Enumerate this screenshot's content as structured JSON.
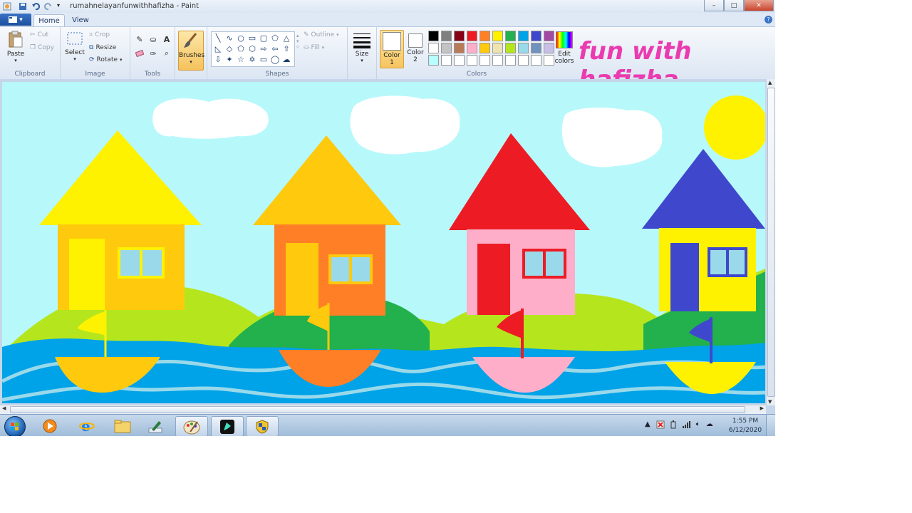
{
  "window": {
    "title": "rumahnelayanfunwithhafizha - Paint",
    "controls": {
      "minimize": "–",
      "maximize": "□",
      "close": "✕"
    }
  },
  "tabs": {
    "app_menu_icon": "paint-menu-icon",
    "home": "Home",
    "view": "View",
    "help": "?"
  },
  "ribbon": {
    "clipboard": {
      "label": "Clipboard",
      "paste": "Paste",
      "cut": "Cut",
      "copy": "Copy"
    },
    "image": {
      "label": "Image",
      "select": "Select",
      "crop": "Crop",
      "resize": "Resize",
      "rotate": "Rotate"
    },
    "tools": {
      "label": "Tools",
      "items": [
        "pencil-icon",
        "fill-bucket-icon",
        "text-icon",
        "eraser-icon",
        "color-picker-icon",
        "magnifier-icon"
      ]
    },
    "brushes": {
      "label": "Brushes"
    },
    "shapes": {
      "label": "Shapes",
      "outline": "Outline",
      "fill": "Fill"
    },
    "size": {
      "label": "Size"
    },
    "colors": {
      "label": "Colors",
      "color1": {
        "line1": "Color",
        "line2": "1",
        "value": "#ffffff"
      },
      "color2": {
        "line1": "Color",
        "line2": "2",
        "value": "#ffffff"
      },
      "edit": {
        "line1": "Edit",
        "line2": "colors"
      },
      "palette": [
        "#000000",
        "#7f7f7f",
        "#880015",
        "#ed1c24",
        "#ff7f27",
        "#fff200",
        "#22b14c",
        "#00a2e8",
        "#3f48cc",
        "#a349a4",
        "#ffffff",
        "#c3c3c3",
        "#b97a57",
        "#ffaec9",
        "#ffc90e",
        "#efe4b0",
        "#b5e61d",
        "#99d9ea",
        "#7092be",
        "#c8bfe7",
        "#b7ffff",
        "#ffffff",
        "#ffffff",
        "#ffffff",
        "#ffffff",
        "#ffffff",
        "#ffffff",
        "#ffffff",
        "#ffffff",
        "#ffffff"
      ]
    }
  },
  "watermark": "fun with hafizha",
  "painting": {
    "colors": {
      "sky": "#b7f8fb",
      "cloud": "#ffffff",
      "sun": "#fff200",
      "hill_light": "#b5e61d",
      "hill_dark": "#22b14c",
      "sea": "#00a2e8",
      "wave": "#99d9ea",
      "house1_roof": "#fff200",
      "house1_wall": "#ffc90e",
      "house1_door": "#fff200",
      "house2_roof": "#ffc90e",
      "house2_wall": "#ff7f27",
      "house2_door": "#ffc90e",
      "house3_roof": "#ed1c24",
      "house3_wall": "#ffaec9",
      "house3_door": "#ed1c24",
      "house4_roof": "#3f48cc",
      "house4_wall": "#fff200",
      "house4_door": "#3f48cc",
      "boat1": "#ffc90e",
      "boat2": "#ff7f27",
      "boat3": "#ffaec9",
      "boat4": "#fff200"
    }
  },
  "taskbar": {
    "items": [
      "media-player-icon",
      "internet-explorer-icon",
      "file-explorer-icon",
      "pen-app-icon",
      "paint-icon",
      "filmora-icon",
      "security-shield-icon"
    ],
    "tray_icons": [
      "show-hidden-icon",
      "action-center-icon",
      "battery-icon",
      "network-signal-icon",
      "volume-icon",
      "cloud-icon"
    ],
    "time": "1:55 PM",
    "date": "6/12/2020"
  }
}
